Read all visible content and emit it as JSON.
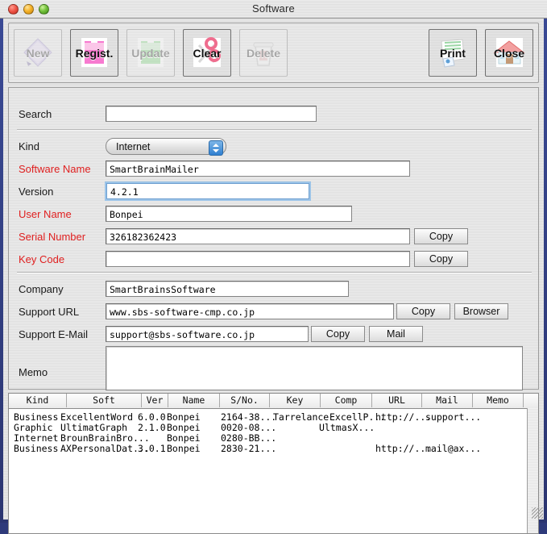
{
  "window": {
    "title": "Software",
    "traffic_lights": [
      "close-button",
      "minimize-button",
      "zoom-button"
    ]
  },
  "toolbar": {
    "buttons": [
      {
        "label": "New",
        "icon": "new-document-icon",
        "enabled": false
      },
      {
        "label": "Regist.",
        "icon": "register-icon",
        "enabled": true
      },
      {
        "label": "Update",
        "icon": "update-icon",
        "enabled": false
      },
      {
        "label": "Clear",
        "icon": "scissors-icon",
        "enabled": true
      },
      {
        "label": "Delete",
        "icon": "trash-icon",
        "enabled": false
      },
      {
        "label": "Print",
        "icon": "printer-icon",
        "enabled": true
      },
      {
        "label": "Close",
        "icon": "house-icon",
        "enabled": true
      }
    ]
  },
  "form": {
    "search": {
      "label": "Search",
      "value": "",
      "placeholder": ""
    },
    "kind": {
      "label": "Kind",
      "value": "Internet"
    },
    "software_name": {
      "label": "Software Name",
      "value": "SmartBrainMailer",
      "required": true
    },
    "version": {
      "label": "Version",
      "value": "4.2.1",
      "focused": true
    },
    "user_name": {
      "label": "User Name",
      "value": "Bonpei",
      "required": true
    },
    "serial_number": {
      "label": "Serial Number",
      "value": "326182362423",
      "required": true,
      "button": "Copy"
    },
    "key_code": {
      "label": "Key Code",
      "value": "",
      "required": true,
      "button": "Copy"
    },
    "company": {
      "label": "Company",
      "value": "SmartBrainsSoftware"
    },
    "support_url": {
      "label": "Support URL",
      "value": "www.sbs-software-cmp.co.jp",
      "button1": "Copy",
      "button2": "Browser"
    },
    "support_email": {
      "label": "Support E-Mail",
      "value": "support@sbs-software.co.jp",
      "button1": "Copy",
      "button2": "Mail"
    },
    "memo": {
      "label": "Memo",
      "value": ""
    }
  },
  "table": {
    "columns": [
      "Kind",
      "Soft",
      "Ver",
      "Name",
      "S/No.",
      "Key",
      "Comp",
      "URL",
      "Mail",
      "Memo"
    ],
    "rows": [
      {
        "Kind": "Business",
        "Soft": "ExcellentWord",
        "Ver": "6.0.0",
        "Name": "Bonpei",
        "S/No.": "2164-38...",
        "Key": "Tarrelance",
        "Comp": "ExcellP...",
        "URL": "http://...",
        "Mail": "support...",
        "Memo": ""
      },
      {
        "Kind": "Graphic",
        "Soft": "UltimatGraph",
        "Ver": "2.1.0",
        "Name": "Bonpei",
        "S/No.": "0020-08...",
        "Key": "",
        "Comp": "UltmasX...",
        "URL": "",
        "Mail": "",
        "Memo": ""
      },
      {
        "Kind": "Internet",
        "Soft": "BrounBrainBro...",
        "Ver": "",
        "Name": "Bonpei",
        "S/No.": "0280-BB...",
        "Key": "",
        "Comp": "",
        "URL": "",
        "Mail": "",
        "Memo": ""
      },
      {
        "Kind": "Business",
        "Soft": "AXPersonalDat...",
        "Ver": "3.0.1",
        "Name": "Bonpei",
        "S/No.": "2830-21...",
        "Key": "",
        "Comp": "",
        "URL": "http://...",
        "Mail": "mail@ax...",
        "Memo": ""
      }
    ]
  },
  "colors": {
    "required_label": "#e02020",
    "focus_ring": "#9cc4e8",
    "window_bg": "#2e3a7a"
  }
}
